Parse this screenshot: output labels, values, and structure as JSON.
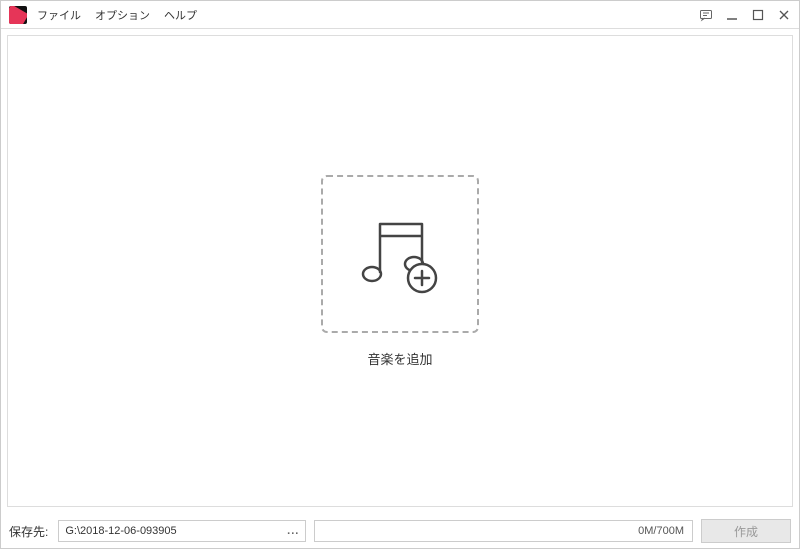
{
  "menu": {
    "file": "ファイル",
    "option": "オプション",
    "help": "ヘルプ"
  },
  "main": {
    "add_music_label": "音楽を追加"
  },
  "footer": {
    "save_to_label": "保存先:",
    "save_path": "G:\\2018-12-06-093905",
    "browse_ellipsis": "...",
    "progress_text": "0M/700M",
    "create_label": "作成"
  }
}
